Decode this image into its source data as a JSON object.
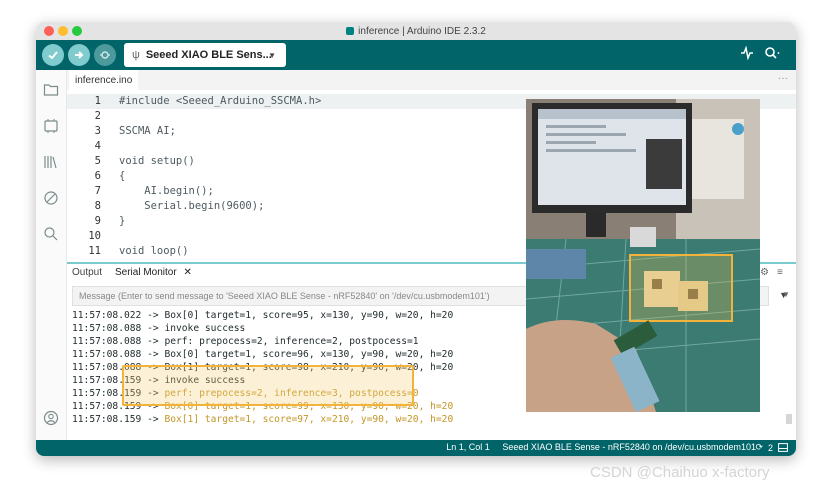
{
  "window": {
    "title": "inference | Arduino IDE 2.3.2"
  },
  "toolbar": {
    "verify_icon": "check-icon",
    "upload_icon": "arrow-right-icon",
    "debug_icon": "debug-icon",
    "board_name": "Seeed XIAO BLE Sens...",
    "usb_icon": "usb-icon",
    "plotter_icon": "pulse-icon",
    "serial_monitor_icon": "magnifier-icon",
    "accent": "#006468"
  },
  "sidebar": {
    "icons": [
      "folder-icon",
      "board-manager-icon",
      "library-icon",
      "debug-disabled-icon",
      "search-icon",
      "account-icon"
    ]
  },
  "editor": {
    "active_tab": "inference.ino",
    "more": "···",
    "lines": [
      {
        "num": "1",
        "code": "#include <Seeed_Arduino_SSCMA.h>"
      },
      {
        "num": "2",
        "code": ""
      },
      {
        "num": "3",
        "code": "SSCMA AI;"
      },
      {
        "num": "4",
        "code": ""
      },
      {
        "num": "5",
        "code": "void setup()"
      },
      {
        "num": "6",
        "code": "{"
      },
      {
        "num": "7",
        "code": "    AI.begin();"
      },
      {
        "num": "8",
        "code": "    Serial.begin(9600);"
      },
      {
        "num": "9",
        "code": "}"
      },
      {
        "num": "10",
        "code": ""
      },
      {
        "num": "11",
        "code": "void loop()"
      }
    ]
  },
  "panel": {
    "tab_output": "Output",
    "tab_serial": "Serial Monitor",
    "close": "✕",
    "message_placeholder": "Message (Enter to send message to 'Seeed XIAO BLE Sense - nRF52840' on '/dev/cu.usbmodem101')"
  },
  "serial": {
    "lines": [
      {
        "ts": "11:57:08.022",
        "body": "Box[0] target=1, score=95, x=130, y=90, w=20, h=20"
      },
      {
        "ts": "11:57:08.088",
        "body": "invoke success"
      },
      {
        "ts": "11:57:08.088",
        "body": "perf: prepocess=2, inference=2, postpocess=1"
      },
      {
        "ts": "11:57:08.088",
        "body": "Box[0] target=1, score=96, x=130, y=90, w=20, h=20"
      },
      {
        "ts": "11:57:08.088",
        "body": "Box[1] target=1, score=98, x=210, y=90, w=20, h=20"
      },
      {
        "ts": "11:57:08.159",
        "body": "invoke success"
      },
      {
        "ts": "11:57:08.159",
        "body": "perf: prepocess=2, inference=3, postpocess=0"
      },
      {
        "ts": "11:57:08.159",
        "body": "Box[0] target=1, score=99, x=130, y=90, w=20, h=20"
      },
      {
        "ts": "11:57:08.159",
        "body": "Box[1] target=1, score=97, x=210, y=90, w=20, h=20"
      }
    ],
    "arrow": "->"
  },
  "statusbar": {
    "position": "Ln 1, Col 1",
    "board_port": "Seeed XIAO BLE Sense - nRF52840 on /dev/cu.usbmodem101",
    "notifications": "2"
  },
  "watermark": "CSDN @Chaihuo x-factory"
}
